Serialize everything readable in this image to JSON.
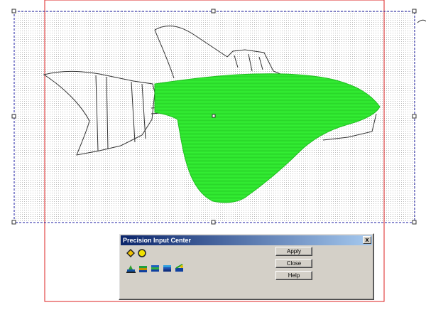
{
  "dialog": {
    "title": "Precision Input Center",
    "close_glyph": "x",
    "buttons": {
      "apply": "Apply",
      "close": "Close",
      "help": "Help"
    },
    "mode_icons": [
      "point-mode-icon",
      "circle-mode-icon"
    ],
    "tool_icons": [
      "digitize-tool-icon",
      "layer-tool-icon",
      "stack-tool-icon",
      "stack-alt-tool-icon",
      "cut-tool-icon"
    ]
  },
  "colors": {
    "fill": "#33ee33",
    "selection": "#1a1aa0",
    "page_border": "#dd2222",
    "outline": "#333333",
    "titlebar_start": "#0a246a",
    "titlebar_end": "#a6caf0",
    "face": "#d4d0c8"
  }
}
